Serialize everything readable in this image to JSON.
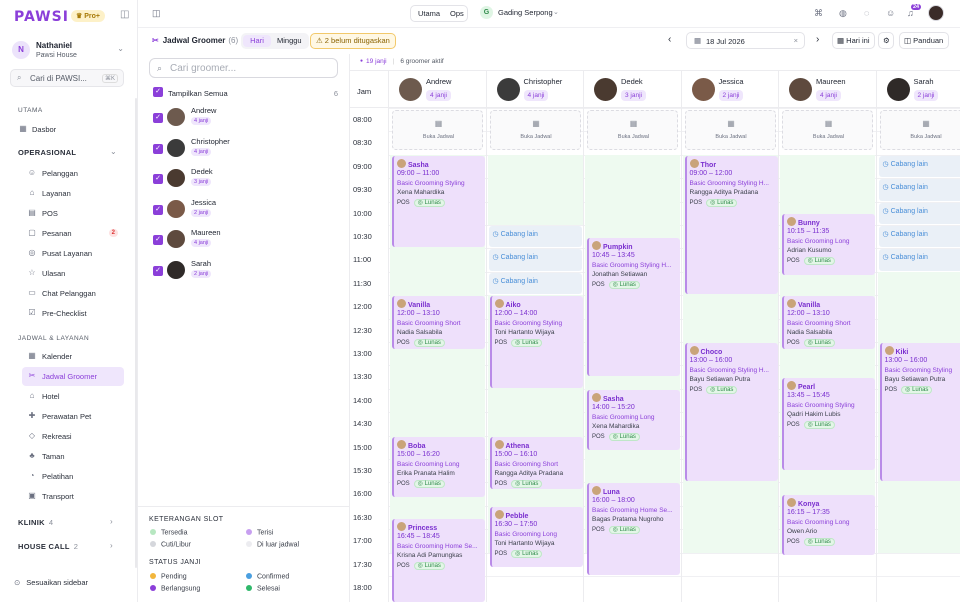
{
  "app": {
    "logo": "PAWSI",
    "pro_badge": "♛ Pro+",
    "user_initial": "N",
    "user_name": "Nathaniel",
    "user_org": "Pawsi House",
    "search_placeholder": "Cari di PAWSI...",
    "search_shortcut": "⌘K"
  },
  "sidebar": {
    "utama_label": "UTAMA",
    "dasbor": "Dasbor",
    "operasional_label": "OPERASIONAL",
    "ops_items": [
      {
        "label": "Pelanggan",
        "icon": "users-icon",
        "glyph": "☺"
      },
      {
        "label": "Layanan",
        "icon": "tag-icon",
        "glyph": "⌂"
      },
      {
        "label": "POS",
        "icon": "pos-icon",
        "glyph": "▤"
      },
      {
        "label": "Pesanan",
        "icon": "order-icon",
        "glyph": "▢",
        "badge": "2"
      },
      {
        "label": "Pusat Layanan",
        "icon": "headset-icon",
        "glyph": "◎"
      },
      {
        "label": "Ulasan",
        "icon": "star-icon",
        "glyph": "☆"
      },
      {
        "label": "Chat Pelanggan",
        "icon": "chat-icon",
        "glyph": "▭"
      },
      {
        "label": "Pre-Checklist",
        "icon": "checklist-icon",
        "glyph": "☑"
      }
    ],
    "jadwal_label": "JADWAL & LAYANAN",
    "jadwal_items": [
      {
        "label": "Kalender",
        "icon": "calendar-icon",
        "glyph": "▦"
      },
      {
        "label": "Jadwal Groomer",
        "icon": "scissors-icon",
        "glyph": "✂",
        "active": true
      },
      {
        "label": "Hotel",
        "icon": "hotel-icon",
        "glyph": "⌂"
      },
      {
        "label": "Perawatan Pet",
        "icon": "paw-icon",
        "glyph": "✚"
      },
      {
        "label": "Rekreasi",
        "icon": "recreation-icon",
        "glyph": "◇"
      },
      {
        "label": "Taman",
        "icon": "park-icon",
        "glyph": "♣"
      },
      {
        "label": "Pelatihan",
        "icon": "training-icon",
        "glyph": "◔"
      },
      {
        "label": "Transport",
        "icon": "truck-icon",
        "glyph": "▣"
      }
    ],
    "klinik": "KLINIK",
    "klinik_count": "4",
    "housecall": "HOUSE CALL",
    "housecall_count": "2",
    "customize": "Sesuaikan sidebar"
  },
  "topbar": {
    "seg_a": "Utama",
    "seg_b": "Ops",
    "loc_initial": "G",
    "location": "Gading Serpong",
    "notif_count": "24"
  },
  "toolbar": {
    "title": "Jadwal Groomer",
    "count": "(6)",
    "toggle_day": "Hari",
    "toggle_week": "Minggu",
    "warning": "⚠ 2 belum ditugaskan",
    "date": "18 Jul 2026",
    "today": "Hari ini",
    "guide": "Panduan"
  },
  "groomer_panel": {
    "search_placeholder": "Cari groomer...",
    "show_all": "Tampilkan Semua",
    "show_all_count": "6",
    "groomers": [
      {
        "name": "Andrew",
        "jobs": "4 janji",
        "color": "#6d5a4e"
      },
      {
        "name": "Christopher",
        "jobs": "4 janji",
        "color": "#3b3b3b"
      },
      {
        "name": "Dedek",
        "jobs": "3 janji",
        "color": "#4a3a30"
      },
      {
        "name": "Jessica",
        "jobs": "2 janji",
        "color": "#7a5a48"
      },
      {
        "name": "Maureen",
        "jobs": "4 janji",
        "color": "#5e4a3e"
      },
      {
        "name": "Sarah",
        "jobs": "2 janji",
        "color": "#2f2a28"
      }
    ],
    "legend_slot_title": "KETERANGAN SLOT",
    "legend_slot": [
      {
        "label": "Tersedia",
        "color": "#b7e7c1"
      },
      {
        "label": "Terisi",
        "color": "#c79ff0"
      },
      {
        "label": "Cuti/Libur",
        "color": "#d5d7dc"
      },
      {
        "label": "Di luar jadwal",
        "color": "#ececf0"
      }
    ],
    "legend_status_title": "STATUS JANJI",
    "legend_status": [
      {
        "label": "Pending",
        "color": "#f2b63c"
      },
      {
        "label": "Confirmed",
        "color": "#4a9fe0"
      },
      {
        "label": "Berlangsung",
        "color": "#8b3fd9"
      },
      {
        "label": "Selesai",
        "color": "#2fb86a"
      }
    ]
  },
  "calendar": {
    "summary_count": "19 janji",
    "summary_active": "6 groomer aktif",
    "time_col": "Jam",
    "times": [
      "08:00",
      "08:30",
      "09:00",
      "09:30",
      "10:00",
      "10:30",
      "11:00",
      "11:30",
      "12:00",
      "12:30",
      "13:00",
      "13:30",
      "14:00",
      "14:30",
      "15:00",
      "15:30",
      "16:00",
      "16:30",
      "17:00",
      "17:30",
      "18:00"
    ],
    "buka_jadwal": "Buka Jadwal",
    "cabang_lain": "Cabang lain",
    "pos": "POS",
    "lunas": "Lunas"
  },
  "columns": [
    {
      "groomer": "Andrew",
      "jobs": "4 janji",
      "avail": [
        [
          9,
          17.5
        ]
      ],
      "cabang": [],
      "appts": [
        {
          "pet": "Sasha",
          "time": "09:00 – 11:00",
          "s": 9,
          "e": 11,
          "service": "Basic Grooming Styling",
          "owner": "Xena Mahardika",
          "tags": true
        },
        {
          "pet": "Vanilla",
          "time": "12:00 – 13:10",
          "s": 12,
          "e": 13.17,
          "service": "Basic Grooming Short",
          "owner": "Nadia Salsabila",
          "tags": false
        },
        {
          "pet": "Boba",
          "time": "15:00 – 16:20",
          "s": 15,
          "e": 16.33,
          "service": "Basic Grooming Long",
          "owner": "Erika Pranata Halim",
          "tags": true
        },
        {
          "pet": "Princess",
          "time": "16:45 – 18:45",
          "s": 16.75,
          "e": 18.75,
          "service": "Basic Grooming Home Se...",
          "owner": "Krisna Adi Pamungkas",
          "tags": true
        }
      ]
    },
    {
      "groomer": "Christopher",
      "jobs": "4 janji",
      "avail": [
        [
          9,
          10.5
        ],
        [
          12,
          17.5
        ]
      ],
      "cabang": [
        10.5,
        11,
        11.5
      ],
      "appts": [
        {
          "pet": "Aiko",
          "time": "12:00 – 14:00",
          "s": 12,
          "e": 14,
          "service": "Basic Grooming Styling",
          "owner": "Toni Hartanto Wijaya",
          "tags": true
        },
        {
          "pet": "Athena",
          "time": "15:00 – 16:10",
          "s": 15,
          "e": 16.17,
          "service": "Basic Grooming Short",
          "owner": "Rangga Aditya Pradana",
          "tags": false
        },
        {
          "pet": "Pebble",
          "time": "16:30 – 17:50",
          "s": 16.5,
          "e": 17.83,
          "service": "Basic Grooming Long",
          "owner": "Toni Hartanto Wijaya",
          "tags": true
        }
      ]
    },
    {
      "groomer": "Dedek",
      "jobs": "3 janji",
      "avail": [
        [
          9,
          17.5
        ]
      ],
      "cabang": [],
      "appts": [
        {
          "pet": "Pumpkin",
          "time": "10:45 – 13:45",
          "s": 10.75,
          "e": 13.75,
          "service": "Basic Grooming Styling H...",
          "owner": "Jonathan Setiawan",
          "tags": true
        },
        {
          "pet": "Sasha",
          "time": "14:00 – 15:20",
          "s": 14,
          "e": 15.33,
          "service": "Basic Grooming Long",
          "owner": "Xena Mahardika",
          "tags": true
        },
        {
          "pet": "Luna",
          "time": "16:00 – 18:00",
          "s": 16,
          "e": 18,
          "service": "Basic Grooming Home Se...",
          "owner": "Bagas Pratama Nugroho",
          "tags": true
        }
      ]
    },
    {
      "groomer": "Jessica",
      "jobs": "2 janji",
      "avail": [
        [
          9,
          17.5
        ]
      ],
      "cabang": [],
      "appts": [
        {
          "pet": "Thor",
          "time": "09:00 – 12:00",
          "s": 9,
          "e": 12,
          "service": "Basic Grooming Styling H...",
          "owner": "Rangga Aditya Pradana",
          "tags": true
        },
        {
          "pet": "Choco",
          "time": "13:00 – 16:00",
          "s": 13,
          "e": 16,
          "service": "Basic Grooming Styling H...",
          "owner": "Bayu Setiawan Putra",
          "tags": true
        }
      ]
    },
    {
      "groomer": "Maureen",
      "jobs": "4 janji",
      "avail": [
        [
          9,
          17.5
        ]
      ],
      "cabang": [],
      "appts": [
        {
          "pet": "Bunny",
          "time": "10:15 – 11:35",
          "s": 10.25,
          "e": 11.58,
          "service": "Basic Grooming Long",
          "owner": "Adrian Kusumo",
          "tags": true
        },
        {
          "pet": "Vanilla",
          "time": "12:00 – 13:10",
          "s": 12,
          "e": 13.17,
          "service": "Basic Grooming Short",
          "owner": "Nadia Salsabila",
          "tags": false
        },
        {
          "pet": "Pearl",
          "time": "13:45 – 15:45",
          "s": 13.75,
          "e": 15.75,
          "service": "Basic Grooming Styling",
          "owner": "Qadri Hakim Lubis",
          "tags": true
        },
        {
          "pet": "Konya",
          "time": "16:15 – 17:35",
          "s": 16.25,
          "e": 17.58,
          "service": "Basic Grooming Long",
          "owner": "Owen Ario",
          "tags": true
        }
      ]
    },
    {
      "groomer": "Sarah",
      "jobs": "2 janji",
      "avail": [
        [
          11.5,
          17.5
        ]
      ],
      "cabang": [
        9,
        9.5,
        10,
        10.5,
        11
      ],
      "appts": [
        {
          "pet": "Kiki",
          "time": "13:00 – 16:00",
          "s": 13,
          "e": 16,
          "service": "Basic Grooming Styling",
          "owner": "Bayu Setiawan Putra",
          "tags": true
        }
      ]
    }
  ]
}
